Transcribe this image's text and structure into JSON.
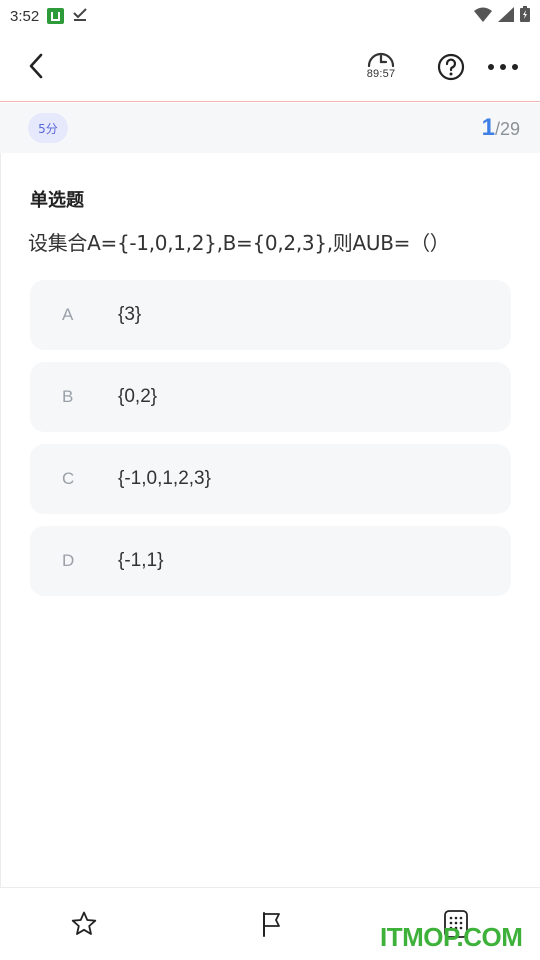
{
  "status_bar": {
    "time": "3:52",
    "icons": [
      "app-notification-icon",
      "download-done-icon",
      "wifi-icon",
      "signal-icon",
      "battery-icon"
    ]
  },
  "header": {
    "timer": "89:57",
    "icons": [
      "back-icon",
      "timer-icon",
      "help-icon",
      "more-icon"
    ]
  },
  "score": {
    "badge": "5分",
    "current": "1",
    "total": "/29"
  },
  "question": {
    "type": "单选题",
    "text": "设集合A={-1,0,1,2},B={0,2,3},则AUB=（）",
    "options": [
      {
        "letter": "A",
        "text": "{3}"
      },
      {
        "letter": "B",
        "text": "{0,2}"
      },
      {
        "letter": "C",
        "text": "{-1,0,1,2,3}"
      },
      {
        "letter": "D",
        "text": "{-1,1}"
      }
    ]
  },
  "bottom_bar": {
    "icons": [
      "star-icon",
      "flag-icon",
      "answer-sheet-icon"
    ]
  },
  "watermark": "ITMOP.COM",
  "colors": {
    "accent": "#3e7fe6",
    "badge_bg": "#e6e8fb",
    "badge_text": "#5868d9",
    "option_bg": "#f6f7f9",
    "header_divider": "#f2b6b6",
    "watermark": "#3db13a"
  }
}
